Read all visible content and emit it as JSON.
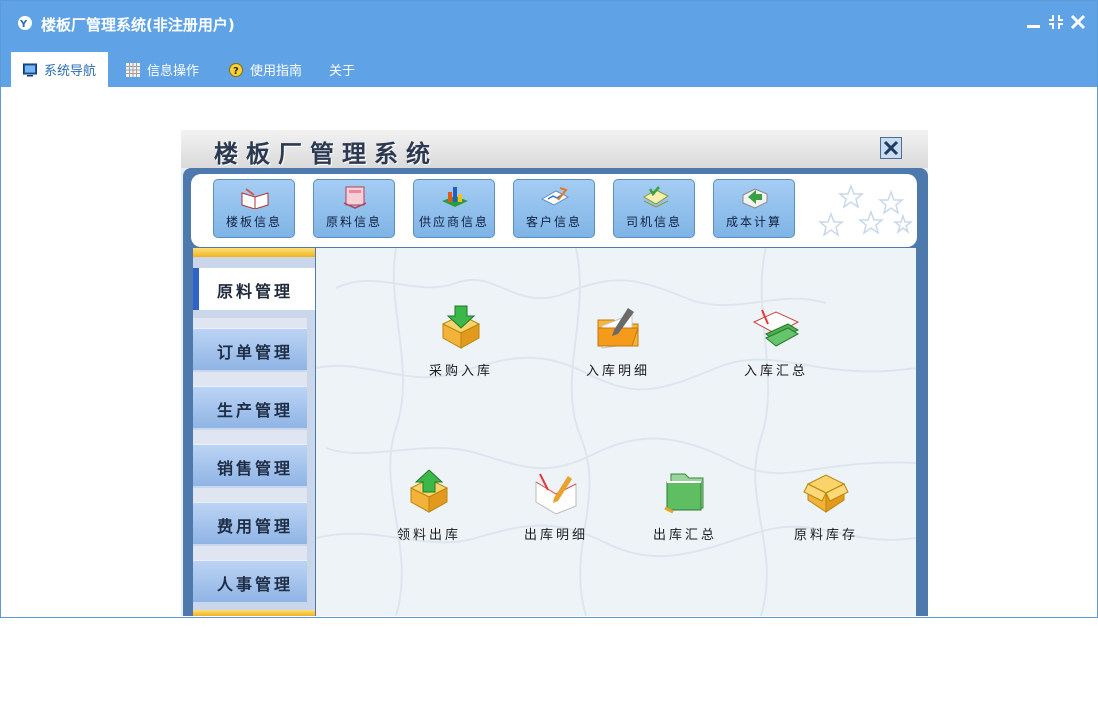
{
  "window": {
    "title": "楼板厂管理系统(非注册用户)"
  },
  "menu_tabs": [
    {
      "label": "系统导航",
      "icon": "monitor-icon"
    },
    {
      "label": "信息操作",
      "icon": "grid-icon"
    },
    {
      "label": "使用指南",
      "icon": "help-icon"
    },
    {
      "label": "关于",
      "icon": ""
    }
  ],
  "panel": {
    "title": "楼板厂管理系统",
    "toolbar": [
      {
        "label": "楼板信息",
        "icon": "book-icon"
      },
      {
        "label": "原料信息",
        "icon": "document-stack-icon"
      },
      {
        "label": "供应商信息",
        "icon": "chart-bars-icon"
      },
      {
        "label": "客户信息",
        "icon": "graph-pencil-icon"
      },
      {
        "label": "司机信息",
        "icon": "check-paper-icon"
      },
      {
        "label": "成本计算",
        "icon": "folder-arrow-icon"
      }
    ],
    "sidebar": [
      {
        "label": "原料管理",
        "active": true
      },
      {
        "label": "订单管理"
      },
      {
        "label": "生产管理"
      },
      {
        "label": "销售管理"
      },
      {
        "label": "费用管理"
      },
      {
        "label": "人事管理"
      }
    ],
    "main_items": [
      {
        "label": "采购入库",
        "icon": "box-down-arrow-icon"
      },
      {
        "label": "入库明细",
        "icon": "folder-pen-icon"
      },
      {
        "label": "入库汇总",
        "icon": "book-pen-icon"
      },
      {
        "label": "领料出库",
        "icon": "box-up-arrow-icon"
      },
      {
        "label": "出库明细",
        "icon": "notebook-pen-icon"
      },
      {
        "label": "出库汇总",
        "icon": "green-folder-icon"
      },
      {
        "label": "原料库存",
        "icon": "box-icon"
      }
    ]
  }
}
